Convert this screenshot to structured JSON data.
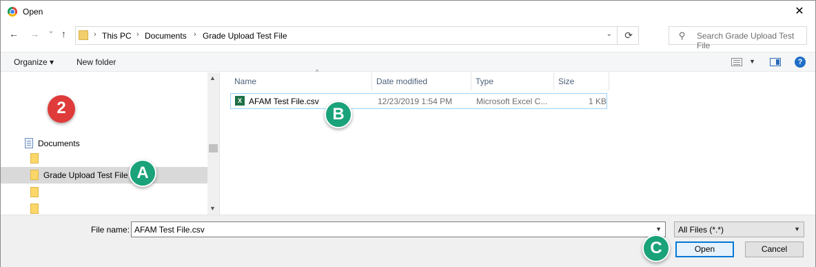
{
  "window": {
    "title": "Open",
    "close_glyph": "✕"
  },
  "nav_buttons": {
    "back": "←",
    "forward": "→",
    "recent": "⌄",
    "up": "↑"
  },
  "address": {
    "breadcrumbs": [
      "This PC",
      "Documents",
      "Grade Upload Test File"
    ],
    "separator": "›",
    "dropdown_glyph": "⌄",
    "refresh_glyph": "⟳"
  },
  "search": {
    "placeholder": "Search Grade Upload Test File",
    "icon": "search-icon"
  },
  "toolbar": {
    "organize_label": "Organize ▾",
    "new_folder_label": "New folder",
    "help_glyph": "?"
  },
  "nav_pane": {
    "items": [
      {
        "label": "Documents",
        "icon": "documents-icon"
      },
      {
        "label": "",
        "icon": "folder-icon"
      },
      {
        "label": "Grade Upload Test File",
        "icon": "folder-icon",
        "selected": true
      },
      {
        "label": "",
        "icon": "folder-icon"
      },
      {
        "label": "",
        "icon": "folder-icon"
      }
    ]
  },
  "columns": [
    "Name",
    "Date modified",
    "Type",
    "Size"
  ],
  "files": [
    {
      "name": "AFAM Test File.csv",
      "date_modified": "12/23/2019 1:54 PM",
      "type": "Microsoft Excel C...",
      "size": "1 KB",
      "icon": "excel-file-icon"
    }
  ],
  "bottom": {
    "file_name_label": "File name:",
    "file_name_value": "AFAM Test File.csv",
    "filter_label": "All Files (*.*)",
    "open_label": "Open",
    "cancel_label": "Cancel"
  },
  "callouts": {
    "step": "2",
    "a": "A",
    "b": "B",
    "c": "C"
  },
  "colors": {
    "selection": "#d9d9d9",
    "accent": "#0078d7",
    "red_badge": "#e03b3b",
    "green_badge": "#1aa27a"
  }
}
